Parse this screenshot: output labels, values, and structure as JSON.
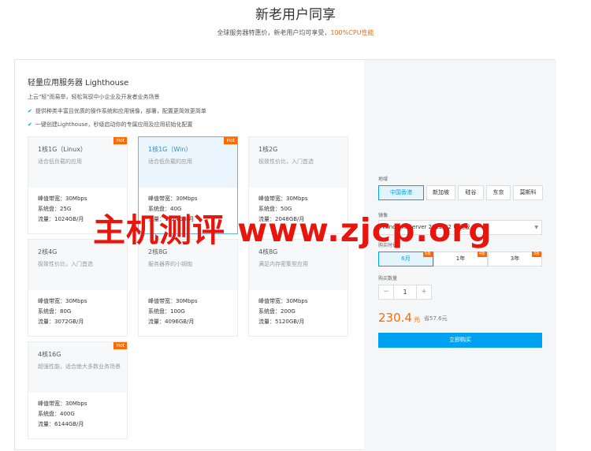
{
  "header": {
    "title": "新老用户同享",
    "subtitle_prefix": "全球服务器特惠价，新老用户均可享受，",
    "subtitle_highlight": "100%CPU性能"
  },
  "product": {
    "title": "轻量应用服务器 Lighthouse",
    "description": "上云\"轻\"而易举，轻松驾驭中小企业及开发者业务场景",
    "features": [
      "提供种类丰富且优质的操作系统和应用镜像，部署，配置更简效更简单",
      "一键创建Lighthouse，秒级启动你的专属应用及应用初始化配置"
    ]
  },
  "cards": [
    {
      "name": "1核1G（Linux）",
      "desc": "适合低负载的应用",
      "bandwidth": "峰值带宽：30Mbps",
      "disk": "系统盘：25G",
      "traffic": "流量：1024GB/月",
      "hot": "Hot"
    },
    {
      "name": "1核1G（Win）",
      "desc": "适合低负载的应用",
      "bandwidth": "峰值带宽：30Mbps",
      "disk": "系统盘：40G",
      "traffic": "流量：1024GB/月",
      "hot": "Hot"
    },
    {
      "name": "1核2G",
      "desc": "极致性价比，入门首选",
      "bandwidth": "峰值带宽：30Mbps",
      "disk": "系统盘：50G",
      "traffic": "流量：2048GB/月"
    },
    {
      "name": "2核4G",
      "desc": "极致性价比，入门首选",
      "bandwidth": "峰值带宽：30Mbps",
      "disk": "系统盘：80G",
      "traffic": "流量：3072GB/月"
    },
    {
      "name": "2核8G",
      "desc": "服务器界的小钢炮",
      "bandwidth": "峰值带宽：30Mbps",
      "disk": "系统盘：100G",
      "traffic": "流量：4096GB/月"
    },
    {
      "name": "4核8G",
      "desc": "满足内存密集型应用",
      "bandwidth": "峰值带宽：30Mbps",
      "disk": "系统盘：200G",
      "traffic": "流量：5120GB/月"
    },
    {
      "name": "4核16G",
      "desc": "超强性能，适合绝大多数业务场景",
      "bandwidth": "峰值带宽：30Mbps",
      "disk": "系统盘：400G",
      "traffic": "流量：6144GB/月",
      "hot": "Hot"
    }
  ],
  "order": {
    "region_label": "地域",
    "regions": [
      "中国香港",
      "新加坡",
      "硅谷",
      "东京",
      "莫斯科"
    ],
    "image_label": "镜像",
    "image_value": "Windows Server 2012 R2 中文版",
    "duration_label": "购买时长",
    "durations": [
      {
        "label": "6月",
        "tag": "5折"
      },
      {
        "label": "1年",
        "tag": "4折"
      },
      {
        "label": "3年",
        "tag": "3折"
      }
    ],
    "quantity_label": "购买数量",
    "minus": "−",
    "quantity": "1",
    "plus": "+",
    "price": "230.4",
    "price_unit": "元",
    "saving": "省57.6元",
    "buy_label": "立即购买"
  },
  "watermark": "主机测评 www.zjcp.org",
  "colors": {
    "accent": "#00a1f1",
    "price": "#ff6a00",
    "hot": "#ff6a00",
    "watermark": "#e8150d"
  }
}
